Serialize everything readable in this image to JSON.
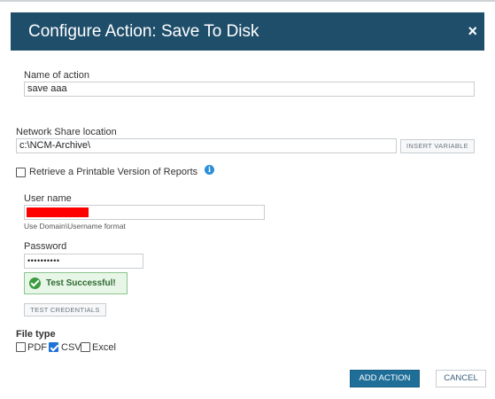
{
  "dialog": {
    "title": "Configure Action: Save To Disk",
    "close_glyph": "×"
  },
  "form": {
    "name_label": "Name of action",
    "name_value": "save aaa",
    "share_label": "Network Share location",
    "share_value": "c:\\NCM-Archive\\",
    "insert_variable_label": "INSERT VARIABLE",
    "printable_label": "Retrieve a Printable Version of Reports",
    "printable_checked": false,
    "info_glyph": "i",
    "username_label": "User name",
    "username_hint": "Use Domain\\Username format",
    "password_label": "Password",
    "password_value": "••••••••••",
    "test_status": "Test Successful!",
    "test_button": "TEST CREDENTIALS",
    "filetype_label": "File type",
    "filetypes": [
      {
        "label": "PDF",
        "checked": false
      },
      {
        "label": "CSV",
        "checked": true
      },
      {
        "label": "Excel",
        "checked": false
      }
    ]
  },
  "footer": {
    "add_label": "ADD ACTION",
    "cancel_label": "CANCEL"
  },
  "colors": {
    "header_bg": "#1f4e6b",
    "primary_button": "#1f6e98",
    "success_bg": "#e8f6e8",
    "redaction": "#ff0000"
  }
}
